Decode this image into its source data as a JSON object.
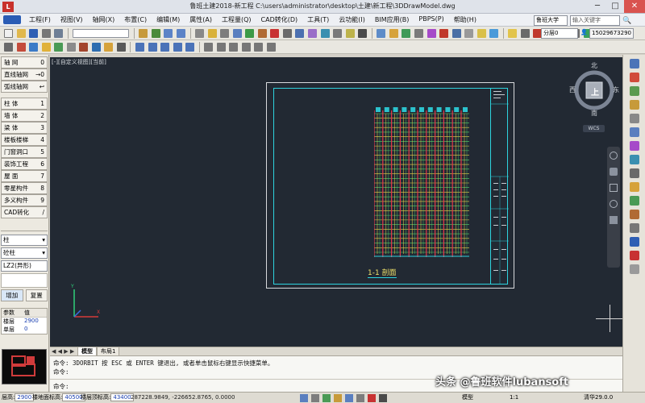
{
  "app": {
    "title": "鲁班土建2018-新工程    C:\\users\\administrator\\desktop\\土建\\新工程\\3DDrawModel.dwg",
    "logo": "L"
  },
  "window_controls": [
    "─",
    "□",
    "✕"
  ],
  "menu": {
    "items": [
      "工程(F)",
      "视图(V)",
      "轴网(X)",
      "布置(C)",
      "编辑(M)",
      "属性(A)",
      "工程量(Q)",
      "CAD转化(D)",
      "工具(T)",
      "云功能(I)",
      "BIM应用(B)",
      "PBPS(P)",
      "帮助(H)"
    ],
    "user": "鲁班大学",
    "search_placeholder": "输入关键字",
    "phone": "15029673290",
    "floor_select": "分层0"
  },
  "left_panel": {
    "categories": [
      {
        "label": "轴    网",
        "count": "0"
      },
      {
        "label": "直线轴网",
        "count": "→0"
      },
      {
        "label": "弧线轴网",
        "count": "↩"
      },
      {
        "label": "柱    体",
        "count": "1"
      },
      {
        "label": "墙    体",
        "count": "2"
      },
      {
        "label": "梁    体",
        "count": "3"
      },
      {
        "label": "楼板楼梯",
        "count": "4"
      },
      {
        "label": "门窗洞口",
        "count": "5"
      },
      {
        "label": "装饰工程",
        "count": "6"
      },
      {
        "label": "屋    面",
        "count": "7"
      },
      {
        "label": "零星构件",
        "count": "8"
      },
      {
        "label": "多义构件",
        "count": "9"
      },
      {
        "label": "CAD转化",
        "count": "/"
      }
    ],
    "type_select": "柱",
    "material_select": "砼柱",
    "component_select": "LZ2(异形)",
    "add_button": "增加",
    "copy_button": "复置",
    "props_header": [
      "参数",
      "值"
    ],
    "props_rows": [
      {
        "name": "楼层",
        "value": "2900"
      },
      {
        "name": "单层",
        "value": "0"
      }
    ]
  },
  "canvas": {
    "view_label": "[-][自定义视图][当前]",
    "section_label": "1-1 剖面",
    "viewcube": {
      "north": "北",
      "south": "南",
      "west": "西",
      "east": "东",
      "top": "上"
    },
    "wcs": "WCS"
  },
  "tabs": [
    "模型",
    "布局1"
  ],
  "command": {
    "lines": [
      "命令: 3DORBIT 按 ESC 或 ENTER 键退出, 或者单击鼠标右键显示快捷菜单。",
      "命令:",
      "命令:"
    ]
  },
  "status": {
    "floor_elev_label": "层高:",
    "floor_elev": "2900",
    "ground_label": "楼地面标高:",
    "ground": "40500",
    "top_label": "楼层顶标高:",
    "top": "43400",
    "coords": "287228.9849, -226652.8765, 0.0000",
    "model_label": "模型",
    "scale": "1:1",
    "slab_label": "清华29.0.0"
  },
  "watermark": "头条 @鲁班软件lubansoft",
  "colors": {
    "canvas_bg": "#222933",
    "frame_cyan": "#2dd3de",
    "label_yellow": "#f1e36a",
    "building_red": "#e2364a",
    "building_yellow": "#ecd64b",
    "building_green": "#56d36a"
  }
}
